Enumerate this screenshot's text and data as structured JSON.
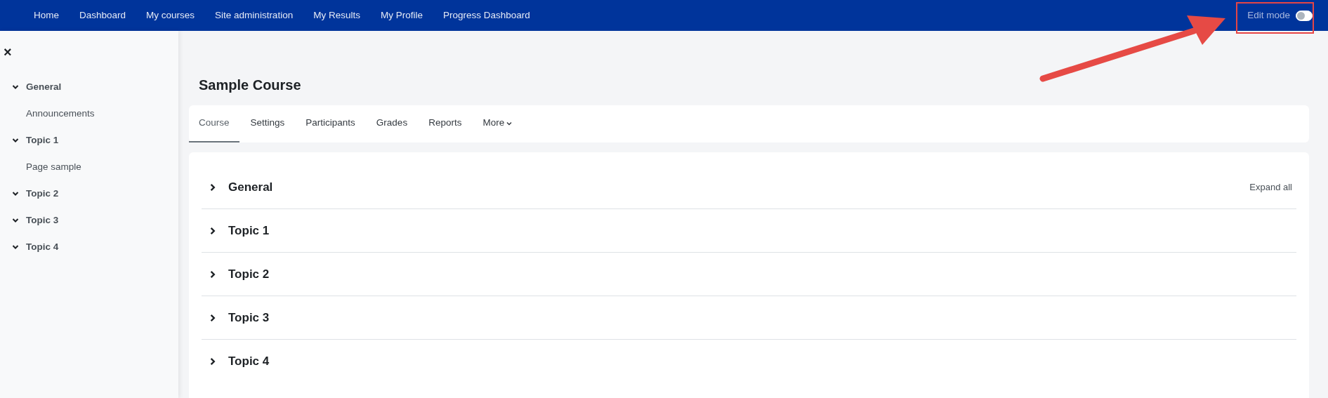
{
  "navbar": {
    "items": [
      {
        "label": "Home"
      },
      {
        "label": "Dashboard"
      },
      {
        "label": "My courses"
      },
      {
        "label": "Site administration"
      },
      {
        "label": "My Results"
      },
      {
        "label": "My Profile"
      },
      {
        "label": "Progress Dashboard"
      }
    ],
    "edit_mode": {
      "label": "Edit mode",
      "on": false
    }
  },
  "sidebar": {
    "close": "×",
    "items": [
      {
        "label": "General",
        "expanded": true,
        "children": [
          {
            "label": "Announcements"
          }
        ]
      },
      {
        "label": "Topic 1",
        "expanded": true,
        "children": [
          {
            "label": "Page sample"
          }
        ]
      },
      {
        "label": "Topic 2",
        "expanded": true
      },
      {
        "label": "Topic 3",
        "expanded": true
      },
      {
        "label": "Topic 4",
        "expanded": true
      }
    ]
  },
  "course": {
    "title": "Sample Course",
    "tabs": [
      {
        "label": "Course",
        "selected": true
      },
      {
        "label": "Settings",
        "selected": false
      },
      {
        "label": "Participants",
        "selected": false
      },
      {
        "label": "Grades",
        "selected": false
      },
      {
        "label": "Reports",
        "selected": false
      },
      {
        "label": "More",
        "selected": false,
        "dropdown": true
      }
    ],
    "expand_all": "Expand all",
    "sections": [
      {
        "title": "General",
        "expanded": false
      },
      {
        "title": "Topic 1",
        "expanded": false
      },
      {
        "title": "Topic 2",
        "expanded": false
      },
      {
        "title": "Topic 3",
        "expanded": false
      },
      {
        "title": "Topic 4",
        "expanded": false
      }
    ]
  }
}
